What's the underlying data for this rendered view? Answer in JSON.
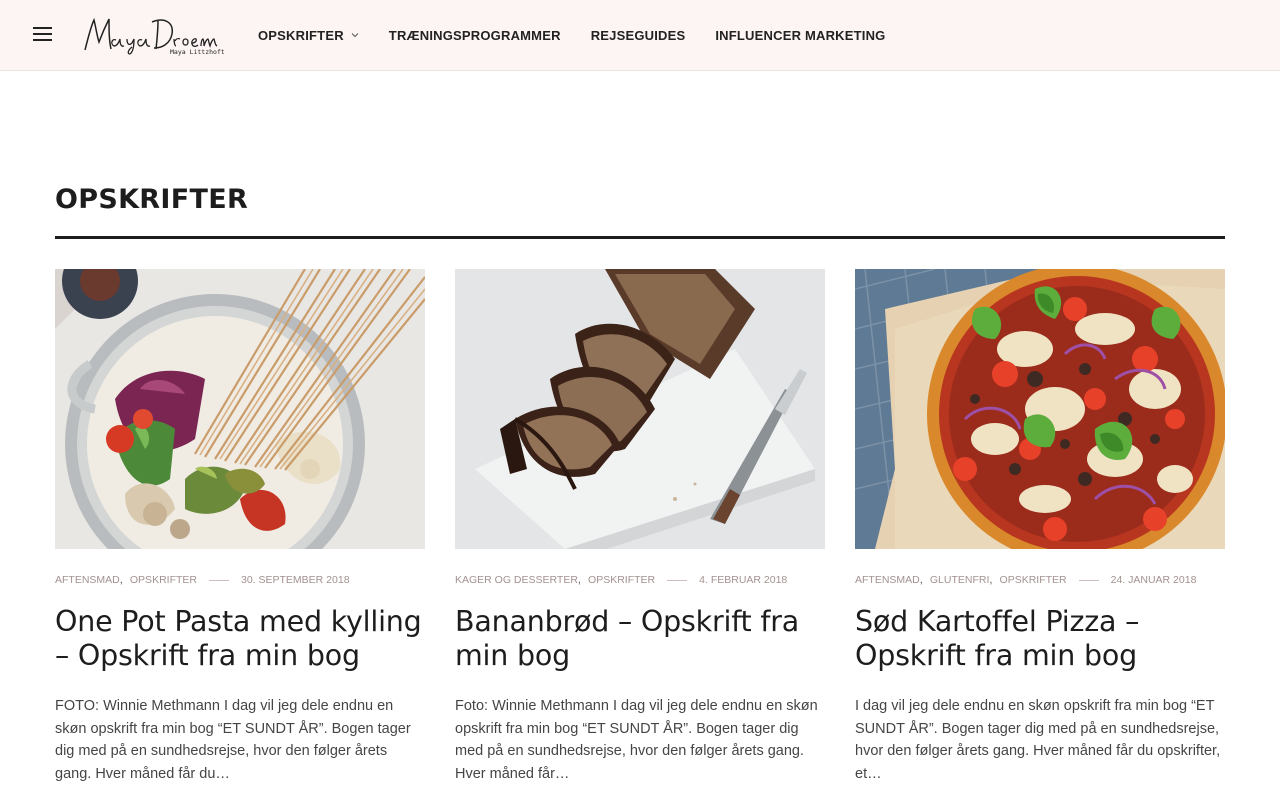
{
  "header": {
    "logo_text": "Maya Droem",
    "logo_subtext": "Maya Littzhoft",
    "nav": [
      {
        "label": "OPSKRIFTER",
        "has_dropdown": true
      },
      {
        "label": "TRÆNINGSPROGRAMMER"
      },
      {
        "label": "REJSEGUIDES"
      },
      {
        "label": "INFLUENCER MARKETING"
      }
    ]
  },
  "page": {
    "title": "OPSKRIFTER"
  },
  "posts": [
    {
      "categories": [
        "AFTENSMAD",
        "OPSKRIFTER"
      ],
      "date": "30. SEPTEMBER 2018",
      "title": "One Pot Pasta med kylling – Opskrift fra min bog",
      "excerpt": "FOTO: Winnie Methmann I dag vil jeg dele endnu en skøn opskrift fra min bog “ET SUNDT ÅR”. Bogen tager dig med på en sundhedsrejse, hvor den følger årets gang. Hver måned får du…"
    },
    {
      "categories": [
        "KAGER OG DESSERTER",
        "OPSKRIFTER"
      ],
      "date": "4. FEBRUAR 2018",
      "title": "Bananbrød – Opskrift fra min bog",
      "excerpt": "Foto: Winnie Methmann I dag vil jeg dele endnu en skøn opskrift fra min bog “ET SUNDT ÅR”. Bogen tager dig med på en sundhedsrejse, hvor den følger årets gang. Hver måned får…"
    },
    {
      "categories": [
        "AFTENSMAD",
        "GLUTENFRI",
        "OPSKRIFTER"
      ],
      "date": "24. JANUAR 2018",
      "title": "Sød Kartoffel Pizza – Opskrift fra min bog",
      "excerpt": "I dag vil jeg dele endnu en skøn opskrift fra min bog “ET SUNDT ÅR”. Bogen tager dig med på en sundhedsrejse, hvor den følger årets gang. Hver måned får du opskrifter, et…"
    }
  ],
  "icons": {
    "menu": "hamburger-menu-icon",
    "dropdown": "chevron-down-icon"
  },
  "colors": {
    "header_bg": "#fdf5f3",
    "meta_text": "#a39290",
    "title_text": "#1d1d1d"
  }
}
